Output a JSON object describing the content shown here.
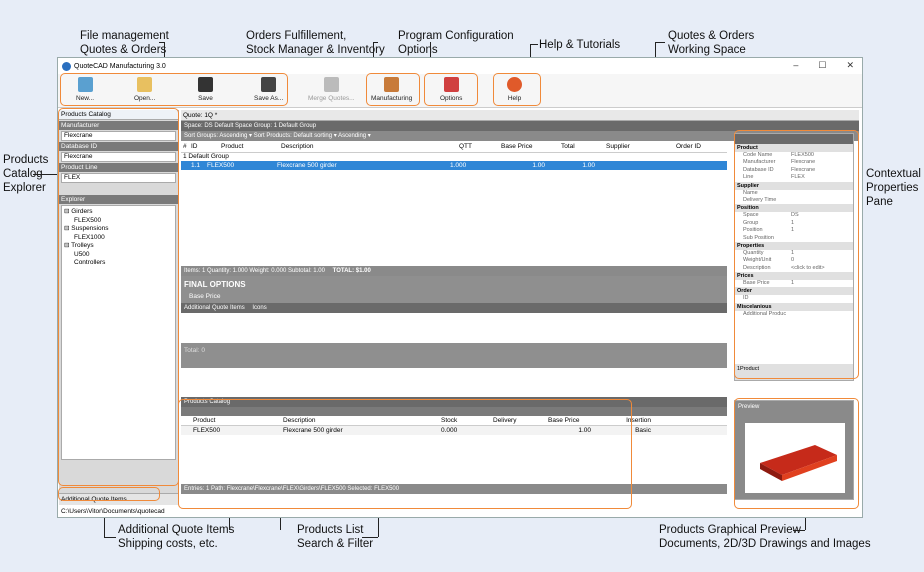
{
  "callouts": {
    "file_mgmt": [
      "File management",
      "Quotes & Orders"
    ],
    "orders": [
      "Orders Fulfillement,",
      "Stock Manager & Inventory"
    ],
    "program": [
      "Program Configuration",
      "Options"
    ],
    "help": "Help & Tutorials",
    "workspace": [
      "Quotes & Orders",
      "Working Space"
    ],
    "catalog_explorer": [
      "Products",
      "Catalog",
      "Explorer"
    ],
    "contextual": [
      "Contextual",
      "Properties",
      "Pane"
    ],
    "additional": [
      "Additional Quote Items",
      "Shipping costs, etc."
    ],
    "products_list": [
      "Products List",
      "Search & Filter"
    ],
    "preview": [
      "Products Graphical Preview",
      "Documents, 2D/3D Drawings and Images"
    ]
  },
  "app": {
    "title": "QuoteCAD Manufacturing 3.0",
    "toolbar": [
      "New...",
      "Open...",
      "Save",
      "Save As...",
      "Merge Quotes...",
      "Manufacturing",
      "Options",
      "Help"
    ],
    "status_path": "C:\\Users\\Vitor\\Documents\\quotecad"
  },
  "left_panel": {
    "title": "Products Catalog",
    "fields": [
      {
        "label": "Manufacturer",
        "value": "Flexcrane"
      },
      {
        "label": "Database ID",
        "value": "Flexcrane"
      },
      {
        "label": "Product Line",
        "value": "FLEX"
      }
    ],
    "explorer_label": "Explorer",
    "tree": [
      "⊟ Girders",
      "FLEX500",
      "⊟ Suspensions",
      "FLEX1000",
      "⊟ Trolleys",
      "U500",
      "Controllers"
    ],
    "bottom": "Additional Quote Items"
  },
  "main": {
    "tab": "Quote: 1Q *",
    "space_bar": "Space:  DS Default Space     Group:  1 Default Group",
    "sort_bar": "Sort Groups:  Ascending  ▾   Sort Products:  Default sorting  ▾  Ascending  ▾",
    "columns": [
      "#",
      "ID",
      "Product",
      "Description",
      "QTT",
      "Base Price",
      "Total",
      "Supplier",
      "Order ID"
    ],
    "group_label": "1 Default Group",
    "row": [
      "1.1",
      "FLEX500",
      "Flexcrane 500 girder",
      "1.000",
      "1.00",
      "1.00"
    ],
    "items_bar": "Items: 1  Quantity: 1.000  Weight: 0.000  Subtotal: 1.00",
    "total": "TOTAL:  $1.00",
    "final_options": "FINAL OPTIONS",
    "base_price": "Base Price",
    "additional_bar": "Additional Quote Items",
    "icons_label": "Icons",
    "total_small": "Total:  0",
    "catalog_title": "Products Catalog",
    "catalog_columns": [
      "Product",
      "Description",
      "Stock",
      "Delivery",
      "Base Price",
      "Insertion"
    ],
    "catalog_row": [
      "FLEX500",
      "Flexcrane 500 girder",
      "0.000",
      "1.00",
      "Basic"
    ],
    "entries_bar": "Entries: 1  Path: Flexcrane\\Flexcrane\\FLEX\\Girders\\FLEX500  Selected: FLEX500"
  },
  "props": {
    "sections": [
      {
        "name": "Product",
        "rows": [
          [
            "Code Name",
            "FLEX500"
          ],
          [
            "Manufacturer",
            "Flexcrane"
          ],
          [
            "Database ID",
            "Flexcrane"
          ],
          [
            "Line",
            "FLEX"
          ]
        ]
      },
      {
        "name": "Supplier",
        "rows": [
          [
            "Name",
            ""
          ],
          [
            "Delivery Time",
            ""
          ]
        ]
      },
      {
        "name": "Position",
        "rows": [
          [
            "Space",
            "DS"
          ],
          [
            "Group",
            "1"
          ],
          [
            "Position",
            "1"
          ],
          [
            "Sub Position",
            ""
          ]
        ]
      },
      {
        "name": "Properties",
        "rows": [
          [
            "Quantity",
            "1"
          ],
          [
            "Weight/Unit",
            "0"
          ],
          [
            "Description",
            "<click to edit>"
          ]
        ]
      },
      {
        "name": "Prices",
        "rows": [
          [
            "Base Price",
            "1"
          ]
        ]
      },
      {
        "name": "Order",
        "rows": [
          [
            "ID",
            ""
          ]
        ]
      },
      {
        "name": "Miscelanious",
        "rows": [
          [
            "Additional Produc",
            ""
          ]
        ]
      }
    ],
    "footer": "1Product"
  },
  "preview_label": "Preview",
  "accent": "#f08a3a"
}
